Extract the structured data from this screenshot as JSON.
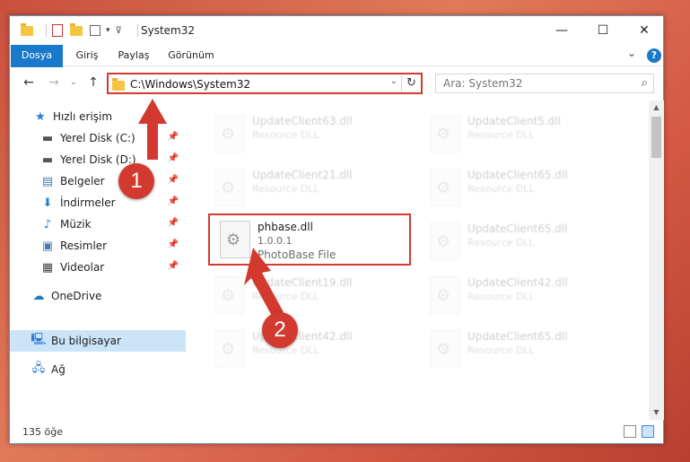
{
  "window": {
    "title": "System32",
    "minimize_icon": "—",
    "maximize_icon": "☐",
    "close_icon": "✕"
  },
  "ribbon": {
    "tabs": [
      {
        "label": "Dosya"
      },
      {
        "label": "Giriş"
      },
      {
        "label": "Paylaş"
      },
      {
        "label": "Görünüm"
      }
    ],
    "help": "?",
    "collapse": "⌄"
  },
  "address": {
    "path": "C:\\Windows\\System32",
    "dropdown": "⌄",
    "refresh": "↻"
  },
  "search": {
    "placeholder": "Ara: System32",
    "icon": "⌕"
  },
  "nav": {
    "back": "←",
    "forward": "→",
    "recent": "⌄",
    "up": "↑"
  },
  "sidebar": {
    "quick_access": "Hızlı erişim",
    "items": [
      {
        "label": "Yerel Disk (C:)"
      },
      {
        "label": "Yerel Disk (D:)"
      },
      {
        "label": "Belgeler"
      },
      {
        "label": "İndirmeler"
      },
      {
        "label": "Müzik"
      },
      {
        "label": "Resimler"
      },
      {
        "label": "Videolar"
      }
    ],
    "onedrive": "OneDrive",
    "this_pc": "Bu bilgisayar",
    "network": "Ağ",
    "pin": "📌"
  },
  "files": [
    {
      "name": "UpdateClient63.dll",
      "type": "Resource DLL"
    },
    {
      "name": "UpdateClient5.dll",
      "type": "Resource DLL"
    },
    {
      "name": "UpdateClient21.dll",
      "type": "Resource DLL"
    },
    {
      "name": "UpdateClient65.dll",
      "type": "Resource DLL"
    },
    {
      "name": "phbase.dll",
      "version": "1.0.0.1",
      "type": "PhotoBase File"
    },
    {
      "name": "UpdateClient65.dll",
      "type": "Resource DLL"
    },
    {
      "name": "UpdateClient19.dll",
      "type": "Resource DLL"
    },
    {
      "name": "UpdateClient42.dll",
      "type": "Resource DLL"
    },
    {
      "name": "UpdateClient42.dll",
      "type": "Resource DLL"
    },
    {
      "name": "UpdateClient65.dll",
      "type": "Resource DLL"
    }
  ],
  "status": {
    "count": "135 öğe"
  },
  "markers": {
    "one": "1",
    "two": "2"
  },
  "colors": {
    "accent": "#1979ca",
    "highlight": "#d33a2f",
    "selected": "#cce4f7"
  }
}
